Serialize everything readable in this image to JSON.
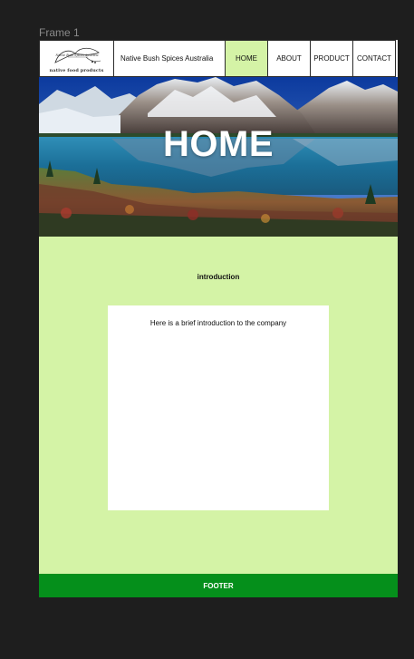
{
  "frame": {
    "label": "Frame 1"
  },
  "nav": {
    "logo_text": "native food products",
    "logo_script": "Native Bush Spices Australia",
    "brand": "Native Bush Spices Australia",
    "items": [
      {
        "label": "HOME",
        "active": true
      },
      {
        "label": "ABOUT",
        "active": false
      },
      {
        "label": "PRODUCT",
        "active": false
      },
      {
        "label": "CONTACT",
        "active": false
      }
    ]
  },
  "hero": {
    "title": "HOME"
  },
  "intro": {
    "heading": "introduction",
    "text": "Here is a brief introduction to the company"
  },
  "footer": {
    "label": "FOOTER"
  },
  "colors": {
    "page_bg": "#1e1e1e",
    "frame_bg": "#d4f3a6",
    "active_nav": "#d4f3a6",
    "footer_bg": "#058f1b"
  }
}
